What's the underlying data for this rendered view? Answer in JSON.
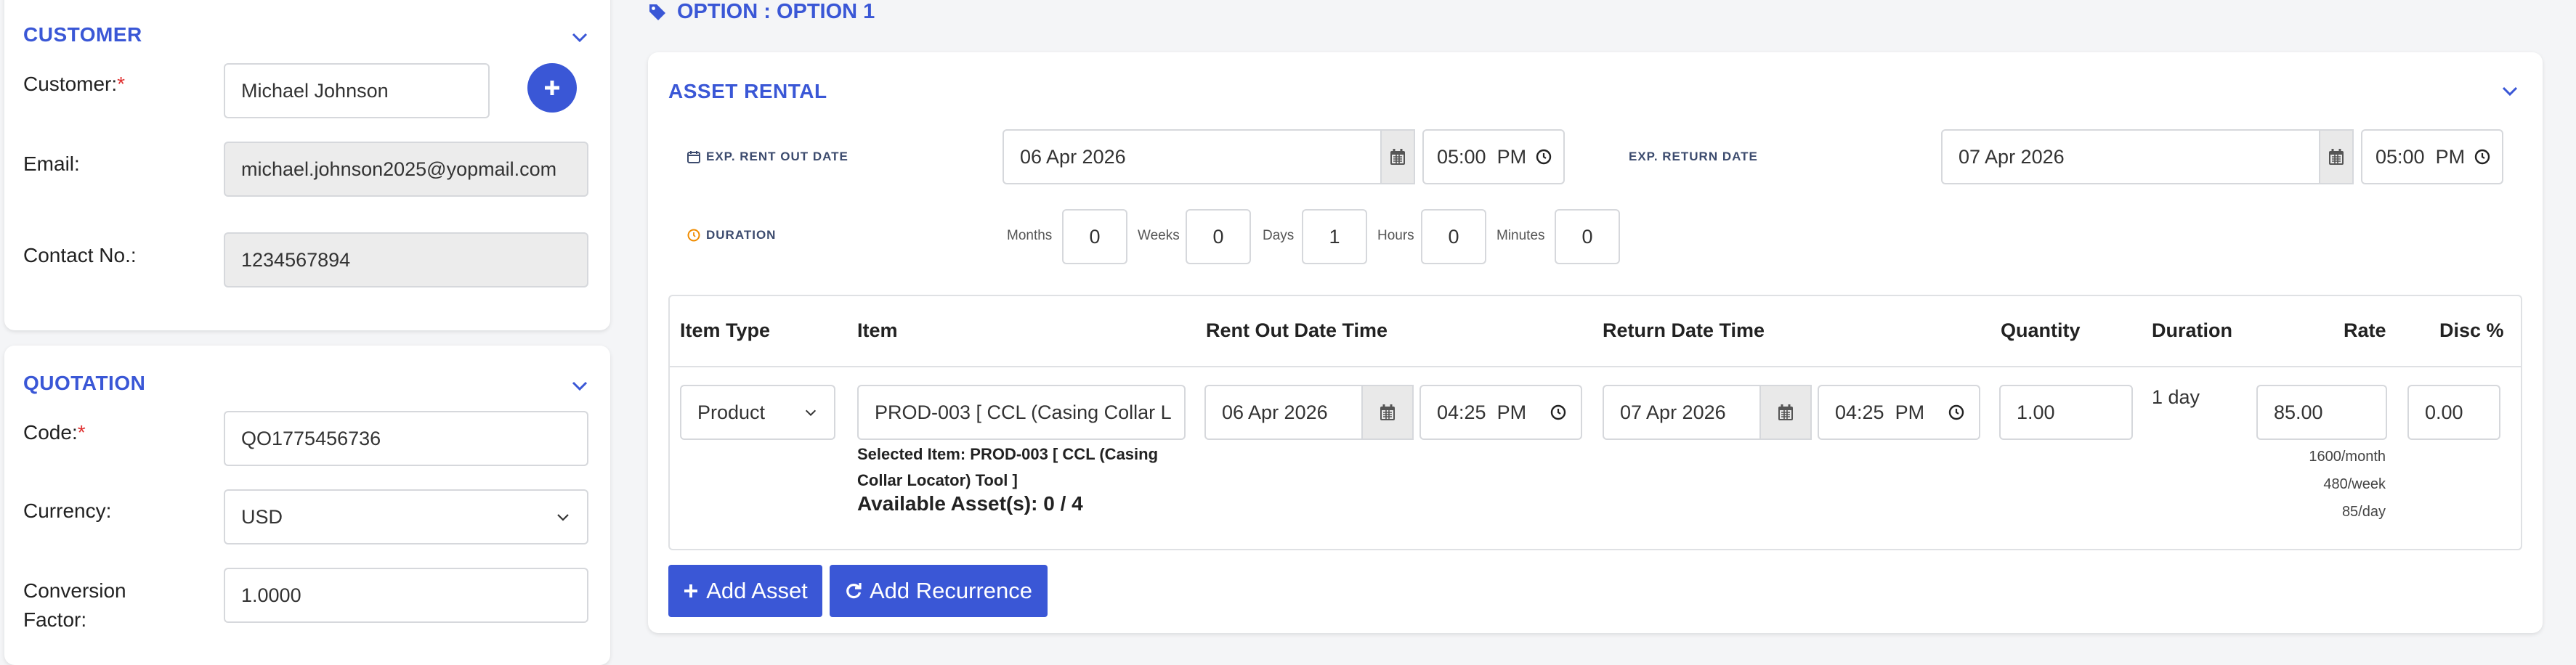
{
  "customer": {
    "title": "CUSTOMER",
    "customer_label": "Customer:",
    "required_mark": "*",
    "customer_value": "Michael Johnson",
    "email_label": "Email:",
    "email_value": "michael.johnson2025@yopmail.com",
    "contact_label": "Contact No.:",
    "contact_value": "1234567894"
  },
  "quotation": {
    "title": "QUOTATION",
    "code_label": "Code:",
    "code_value": "QO1775456736",
    "currency_label": "Currency:",
    "currency_value": "USD",
    "conversion_label_1": "Conversion",
    "conversion_label_2": "Factor:",
    "conversion_value": "1.0000"
  },
  "option": {
    "title": "OPTION : OPTION 1",
    "icon": "tag-icon"
  },
  "asset_rental": {
    "title": "ASSET RENTAL",
    "rent_out_label": "EXP. RENT OUT DATE",
    "rent_out_date": "06 Apr 2026",
    "rent_out_time": "05:00  PM",
    "return_label": "EXP. RETURN DATE",
    "return_date": "07 Apr 2026",
    "return_time": "05:00  PM",
    "duration_label": "DURATION",
    "duration": {
      "months_label": "Months",
      "months": "0",
      "weeks_label": "Weeks",
      "weeks": "0",
      "days_label": "Days",
      "days": "1",
      "hours_label": "Hours",
      "hours": "0",
      "minutes_label": "Minutes",
      "minutes": "0"
    },
    "table": {
      "headers": {
        "item_type": "Item Type",
        "item": "Item",
        "rent_out": "Rent Out Date Time",
        "return": "Return Date Time",
        "quantity": "Quantity",
        "duration": "Duration",
        "rate": "Rate",
        "disc": "Disc %"
      },
      "row": {
        "item_type": "Product",
        "item": "PROD-003 [ CCL (Casing Collar L",
        "selected_line1": "Selected Item: PROD-003 [ CCL (Casing",
        "selected_line2": "Collar Locator) Tool ]",
        "available": "Available Asset(s): 0 / 4",
        "rent_out_date": "06 Apr 2026",
        "rent_out_time": "04:25  PM",
        "return_date": "07 Apr 2026",
        "return_time": "04:25  PM",
        "quantity": "1.00",
        "duration": "1 day",
        "rate": "85.00",
        "rate_month": "1600/month",
        "rate_week": "480/week",
        "rate_day": "85/day",
        "disc": "0.00"
      }
    },
    "add_asset_label": "Add Asset",
    "add_recurrence_label": "Add Recurrence"
  },
  "colors": {
    "accent": "#3a57d6",
    "required": "#e03131",
    "duration_icon": "#f08c00"
  }
}
